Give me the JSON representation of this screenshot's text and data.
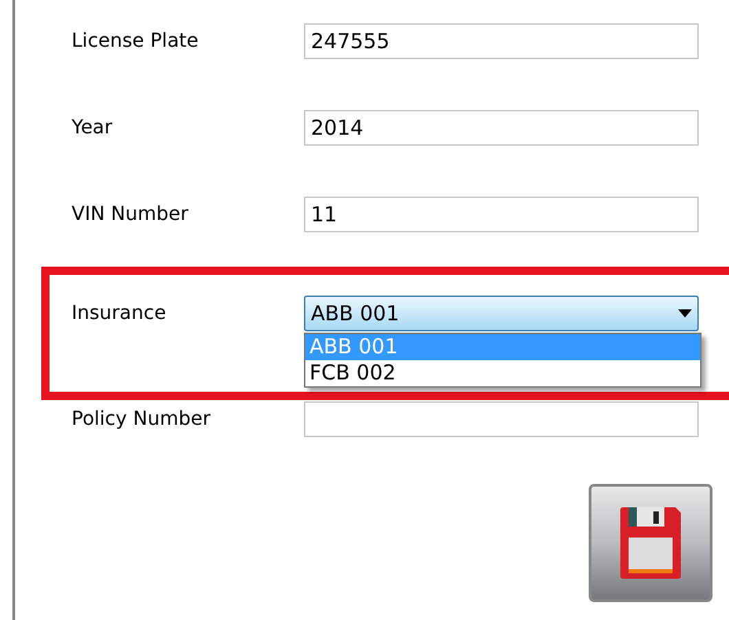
{
  "fields": [
    {
      "label": "License Plate",
      "kind": "text",
      "value": "247555",
      "highlighted": false
    },
    {
      "label": "Year",
      "kind": "text",
      "value": "2014",
      "highlighted": false
    },
    {
      "label": "VIN Number",
      "kind": "text",
      "value": "11",
      "highlighted": false
    },
    {
      "label": "Insurance",
      "kind": "select",
      "value": "ABB 001",
      "expanded": true,
      "highlighted": true,
      "options": [
        {
          "label": "ABB 001",
          "selected": true
        },
        {
          "label": "FCB 002",
          "selected": false
        }
      ]
    },
    {
      "label": "Policy Number",
      "kind": "text",
      "highlighted": false
    }
  ]
}
